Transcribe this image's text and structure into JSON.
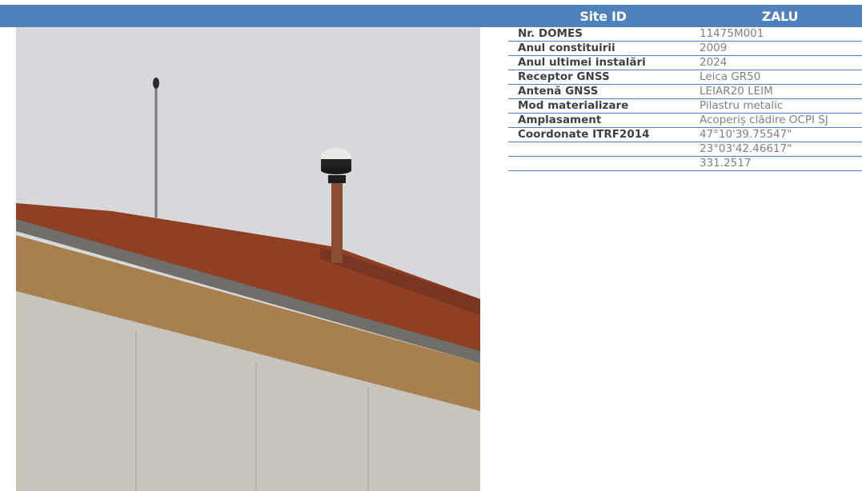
{
  "header": {
    "label": "Site ID",
    "value": "ZALU"
  },
  "rows": [
    {
      "label": "Nr. DOMES",
      "value": "11475M001"
    },
    {
      "label": "Anul constituirii",
      "value": "2009"
    },
    {
      "label": "Anul ultimei instalări",
      "value": "2024"
    },
    {
      "label": "Receptor GNSS",
      "value": "Leica GR50"
    },
    {
      "label": "Antenă GNSS",
      "value": "LEIAR20 LEIM"
    },
    {
      "label": "Mod materializare",
      "value": "Pilastru metalic"
    },
    {
      "label": "Amplasament",
      "value": "Acoperiș clădire OCPI SJ"
    },
    {
      "label": "Coordonate ITRF2014",
      "value": "47°10'39.75547\""
    },
    {
      "label": "",
      "value": "23°03'42.46617\""
    },
    {
      "label": "",
      "value": "331.2517"
    }
  ],
  "colors": {
    "accent": "#4f81bd",
    "label_text": "#404040",
    "value_text": "#808080"
  }
}
